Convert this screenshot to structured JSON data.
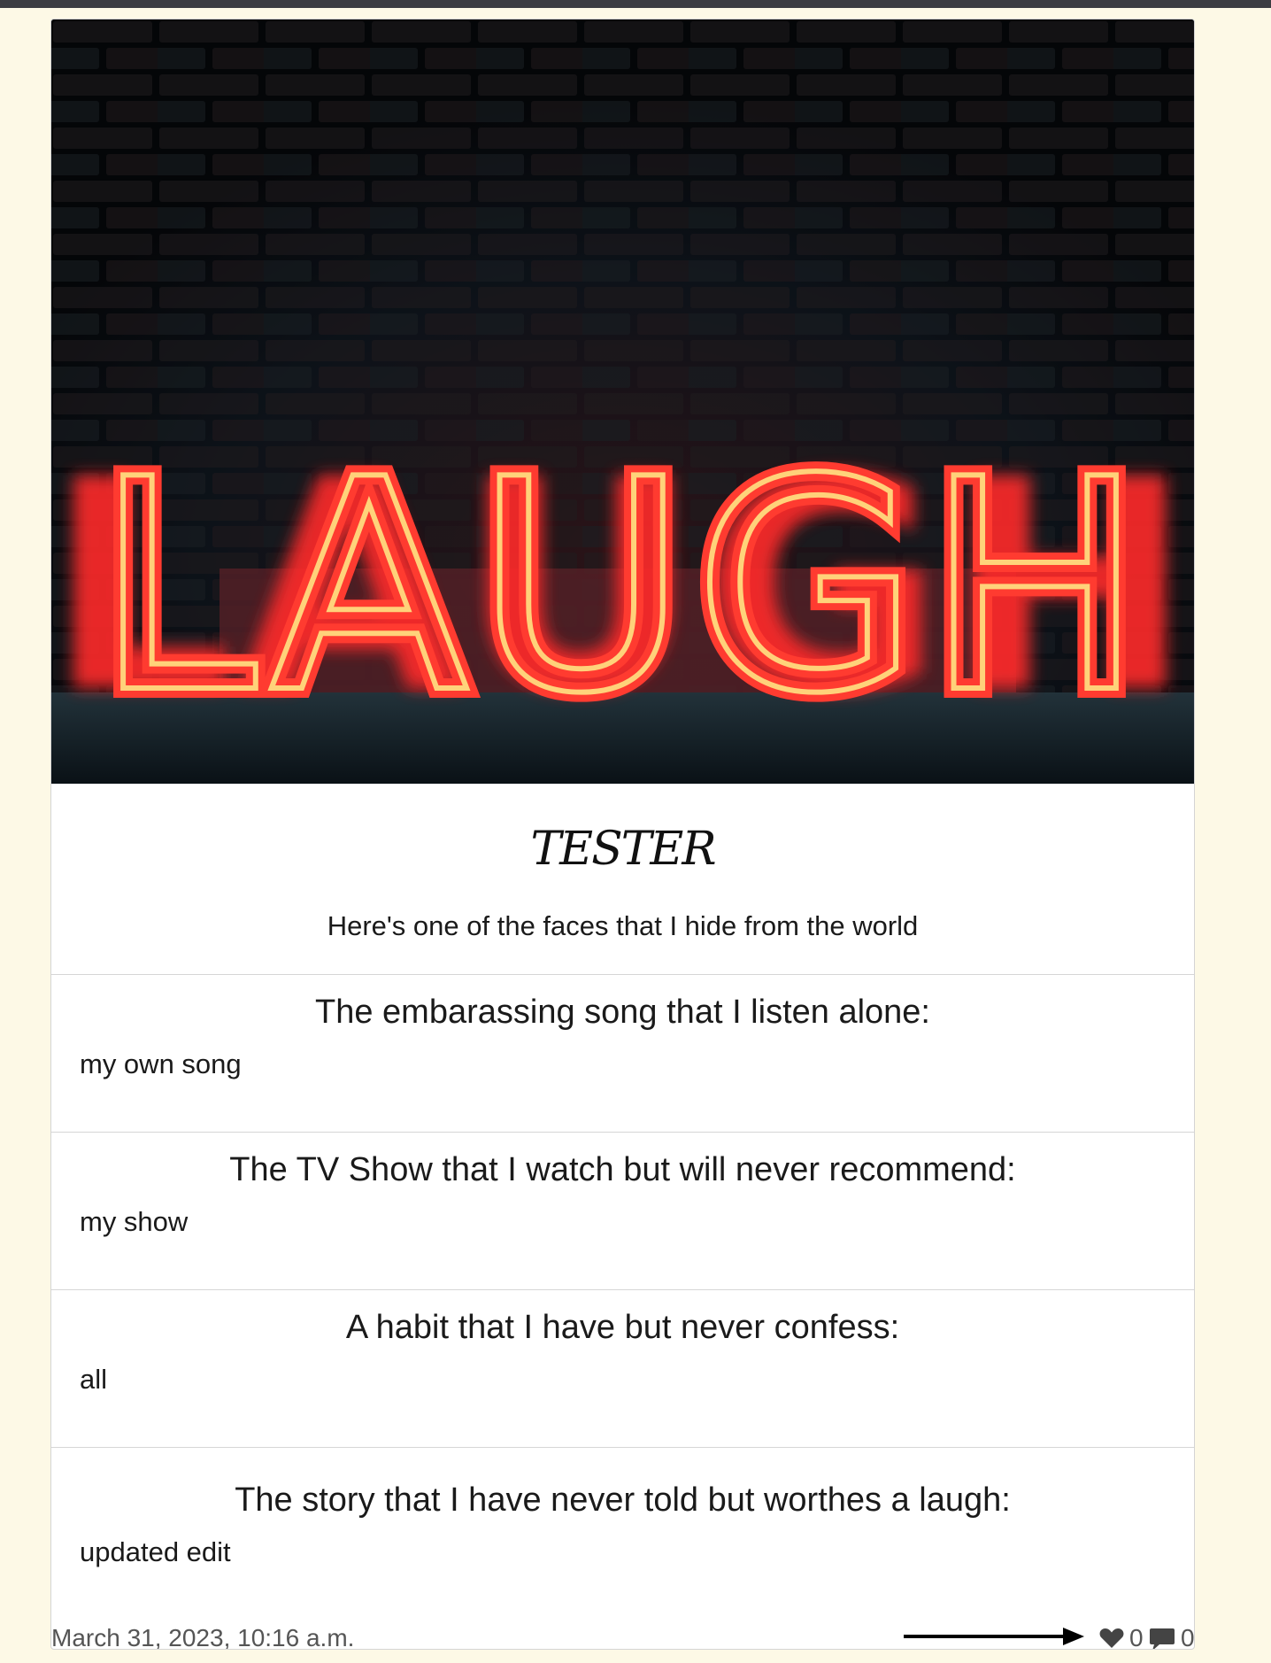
{
  "post": {
    "title": "TESTER",
    "subtitle": "Here's one of the faces that I hide from the world",
    "image_sign_text": "LAUGH"
  },
  "qa": [
    {
      "question": "The embarassing song that I listen alone:",
      "answer": "my own song"
    },
    {
      "question": "The TV Show that I watch but will never recommend:",
      "answer": "my show"
    },
    {
      "question": "A habit that I have but never confess:",
      "answer": "all"
    },
    {
      "question": "The story that I have never told but worthes a laugh:",
      "answer": "updated edit"
    }
  ],
  "footer": {
    "date": "March 31, 2023, 10:16 a.m.",
    "likes": "0",
    "comments": "0",
    "arrow_icon": "right-arrow-icon",
    "like_icon": "heart-icon",
    "comment_icon": "speech-bubble-icon"
  }
}
